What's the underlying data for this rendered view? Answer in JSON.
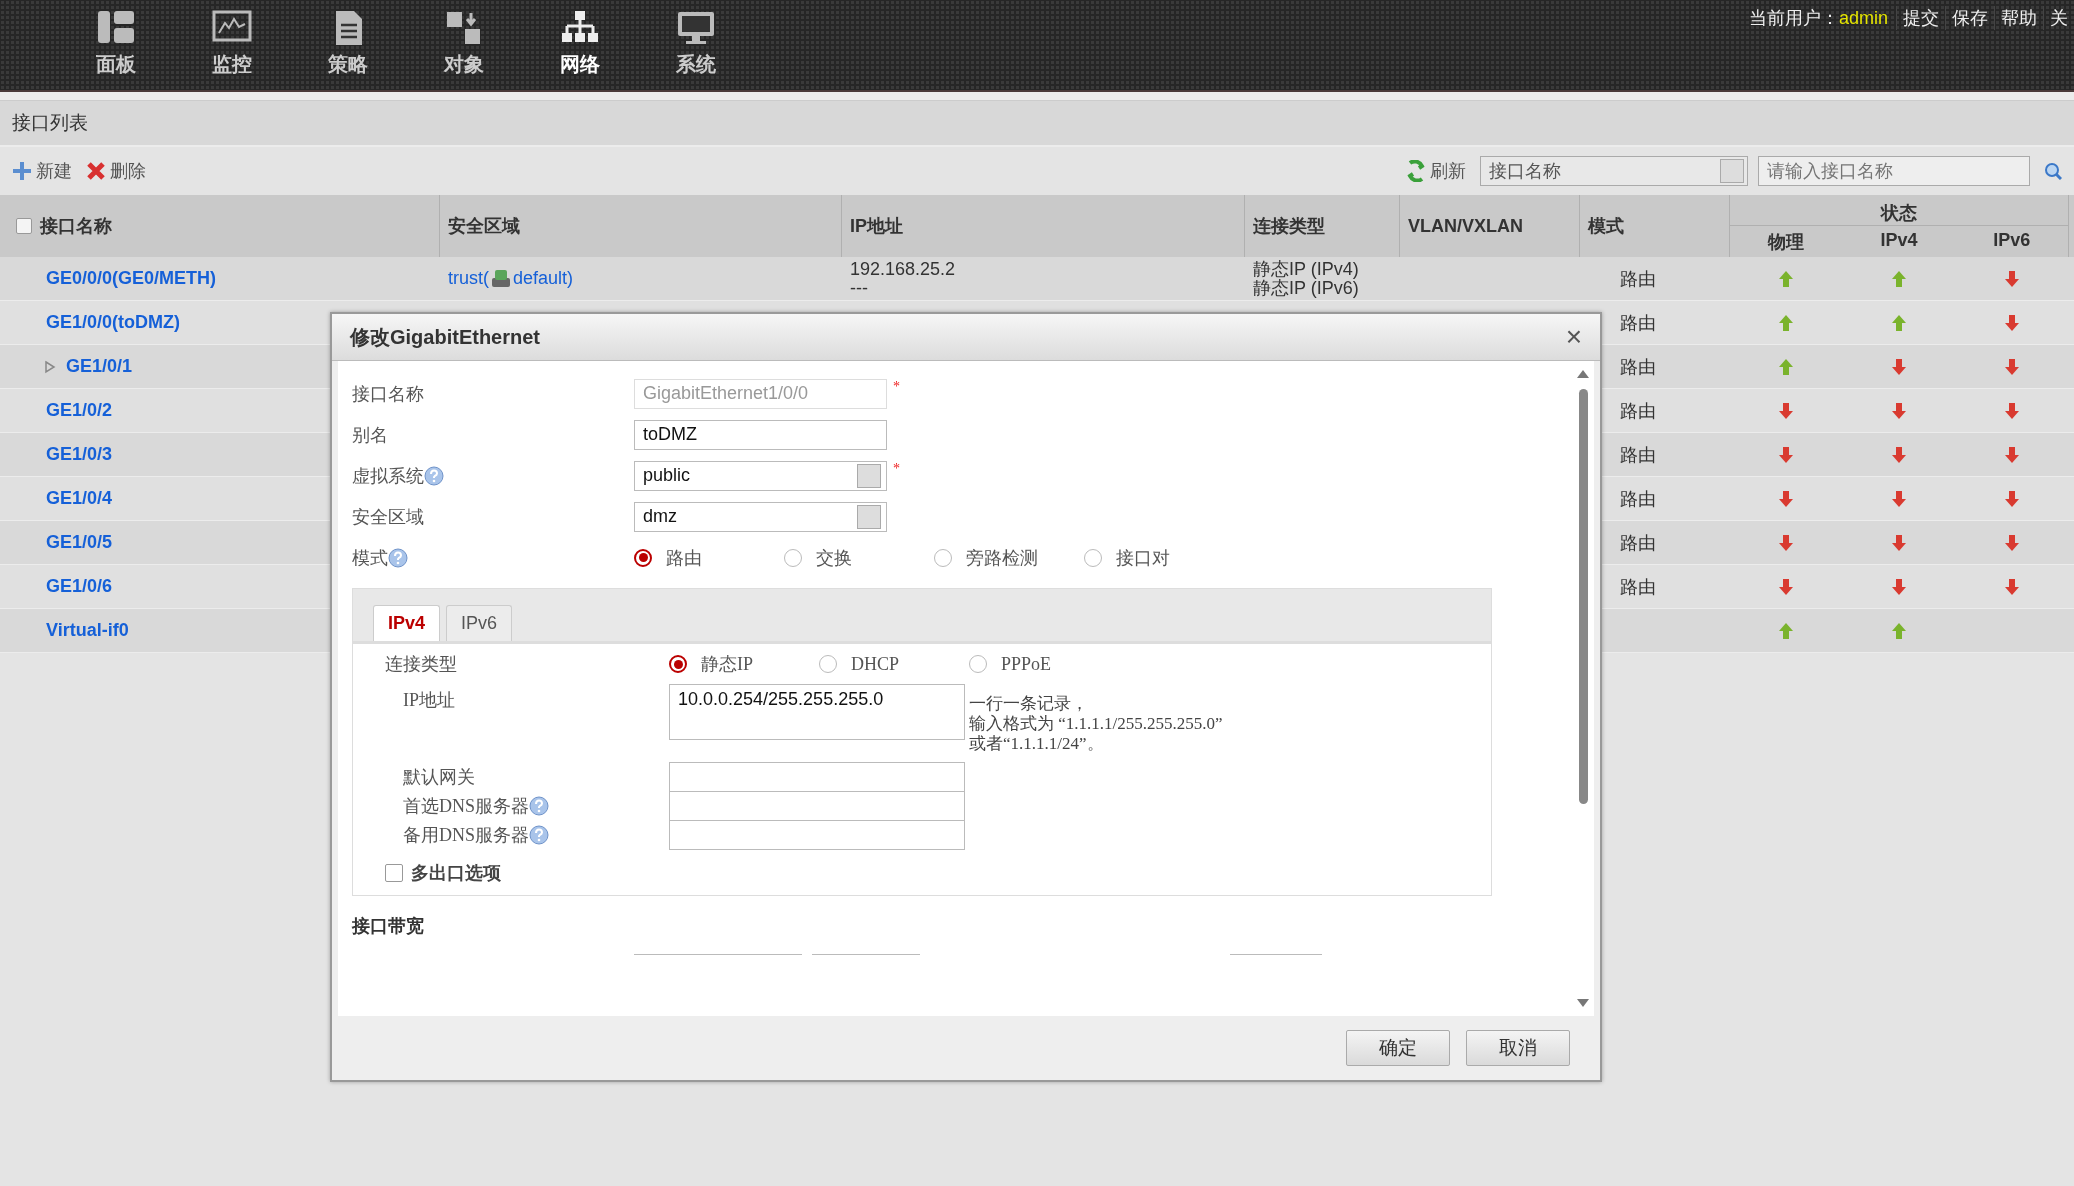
{
  "top_nav": {
    "items": [
      {
        "label": "面板",
        "selected": false
      },
      {
        "label": "监控",
        "selected": false
      },
      {
        "label": "策略",
        "selected": false
      },
      {
        "label": "对象",
        "selected": false
      },
      {
        "label": "网络",
        "selected": true
      },
      {
        "label": "系统",
        "selected": false
      }
    ],
    "user_label": "当前用户：",
    "user": "admin",
    "links": [
      "提交",
      "保存",
      "帮助",
      "关"
    ]
  },
  "panel_title": "接口列表",
  "toolbar": {
    "new": "新建",
    "delete": "删除",
    "refresh": "刷新",
    "filter": "接口名称",
    "search_placeholder": "请输入接口名称"
  },
  "table": {
    "select_all_checked": false,
    "columns": [
      "接口名称",
      "安全区域",
      "IP地址",
      "连接类型",
      "VLAN/VXLAN",
      "模式"
    ],
    "status_group": "状态",
    "status_columns": [
      "物理",
      "IPv4",
      "IPv6"
    ],
    "rows": [
      {
        "name": "GE0/0/0(GE0/METH)",
        "collapsible": false,
        "zone_before": "trust(",
        "zone_after": "default)",
        "ip": [
          "192.168.25.2",
          "---"
        ],
        "conn": [
          "静态IP (IPv4)",
          "静态IP (IPv6)"
        ],
        "mode": "路由",
        "status": [
          {
            "up": true
          },
          {
            "up": true
          },
          {
            "up": false
          }
        ]
      },
      {
        "name": "GE1/0/0(toDMZ)",
        "collapsible": false,
        "mode": "路由",
        "status": [
          {
            "up": true
          },
          {
            "up": true
          },
          {
            "up": false
          }
        ]
      },
      {
        "name": "GE1/0/1",
        "collapsible": true,
        "mode": "路由",
        "status": [
          {
            "up": true
          },
          {
            "up": false
          },
          {
            "up": false
          }
        ]
      },
      {
        "name": "GE1/0/2",
        "collapsible": false,
        "mode": "路由",
        "status": [
          {
            "up": false
          },
          {
            "up": false
          },
          {
            "up": false
          }
        ]
      },
      {
        "name": "GE1/0/3",
        "collapsible": false,
        "mode": "路由",
        "status": [
          {
            "up": false
          },
          {
            "up": false
          },
          {
            "up": false
          }
        ]
      },
      {
        "name": "GE1/0/4",
        "collapsible": false,
        "mode": "路由",
        "status": [
          {
            "up": false
          },
          {
            "up": false
          },
          {
            "up": false
          }
        ]
      },
      {
        "name": "GE1/0/5",
        "collapsible": false,
        "mode": "路由",
        "status": [
          {
            "up": false
          },
          {
            "up": false
          },
          {
            "up": false
          }
        ]
      },
      {
        "name": "GE1/0/6",
        "collapsible": false,
        "mode": "路由",
        "status": [
          {
            "up": false
          },
          {
            "up": false
          },
          {
            "up": false
          }
        ]
      },
      {
        "name": "Virtual-if0",
        "collapsible": false,
        "status": [
          {
            "up": true
          },
          {
            "up": true
          }
        ]
      }
    ]
  },
  "dialog": {
    "title": "修改GigabitEthernet",
    "close": "×",
    "fields": [
      {
        "kind": "text",
        "label": "接口名称",
        "value": "GigabitEthernet1/0/0",
        "disabled": true,
        "required_mark": "*",
        "help": false
      },
      {
        "kind": "text",
        "label": "别名",
        "value": "toDMZ",
        "disabled": false,
        "help": false
      },
      {
        "kind": "select",
        "label": "虚拟系统",
        "value": "public",
        "disabled": false,
        "required_mark": "*",
        "help": true
      },
      {
        "kind": "select",
        "label": "安全区域",
        "value": "dmz",
        "disabled": false,
        "help": false
      }
    ],
    "mode": {
      "label": "模式",
      "help": true,
      "options": [
        {
          "label": "路由",
          "selected": true
        },
        {
          "label": "交换",
          "selected": false
        },
        {
          "label": "旁路检测",
          "selected": false
        },
        {
          "label": "接口对",
          "selected": false
        }
      ]
    },
    "tabs": [
      {
        "label": "IPv4",
        "selected": true
      },
      {
        "label": "IPv6",
        "selected": false
      }
    ],
    "conn_type": {
      "label": "连接类型",
      "options": [
        {
          "label": "静态IP",
          "selected": true
        },
        {
          "label": "DHCP",
          "selected": false
        },
        {
          "label": "PPPoE",
          "selected": false
        }
      ]
    },
    "ip": {
      "label": "IP地址",
      "value": "10.0.0.254/255.255.255.0",
      "hint": [
        "一行一条记录，",
        "输入格式为 “1.1.1.1/255.255.255.0”",
        "或者“1.1.1.1/24”。"
      ]
    },
    "extra_fields": [
      {
        "label": "默认网关",
        "help": false
      },
      {
        "label": "首选DNS服务器",
        "help": true
      },
      {
        "label": "备用DNS服务器",
        "help": true
      }
    ],
    "multi_exit": {
      "label": "多出口选项",
      "checked": false
    },
    "bandwidth_title": "接口带宽",
    "buttons": [
      "确定",
      "取消"
    ]
  }
}
